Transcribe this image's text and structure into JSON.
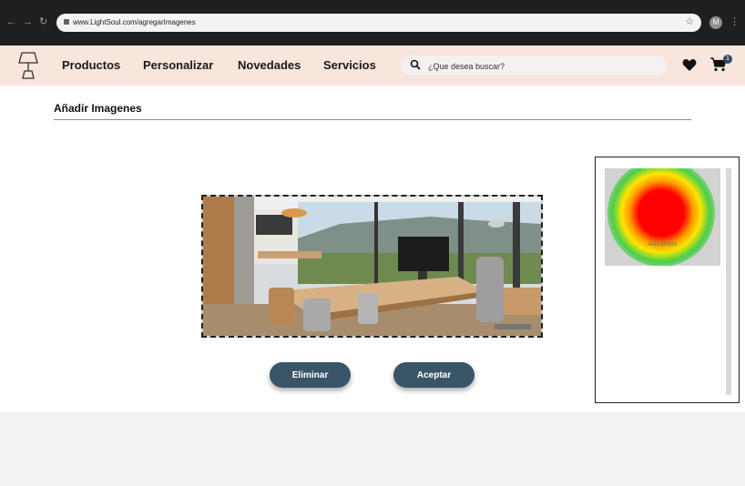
{
  "browser": {
    "url": "www.LightSoul.com/agregarImagenes",
    "profile_initial": "M",
    "icons": [
      "back-icon",
      "forward-icon",
      "reload-icon",
      "lock-icon",
      "star-icon",
      "kebab-icon"
    ]
  },
  "header": {
    "menu": [
      "Productos",
      "Personalizar",
      "Novedades",
      "Servicios"
    ],
    "search_placeholder": "¿Que desea buscar?",
    "cart_count": "1",
    "icons": [
      "lamp-logo-icon",
      "search-icon",
      "heart-icon",
      "cart-icon"
    ],
    "background": "#f8e5dc"
  },
  "main": {
    "title": "Añadir Imagenes",
    "buttons": {
      "delete": "Eliminar",
      "accept": "Aceptar"
    },
    "button_color": "#3b5568"
  },
  "side_panel": {
    "thumb_label": "Add photo"
  }
}
